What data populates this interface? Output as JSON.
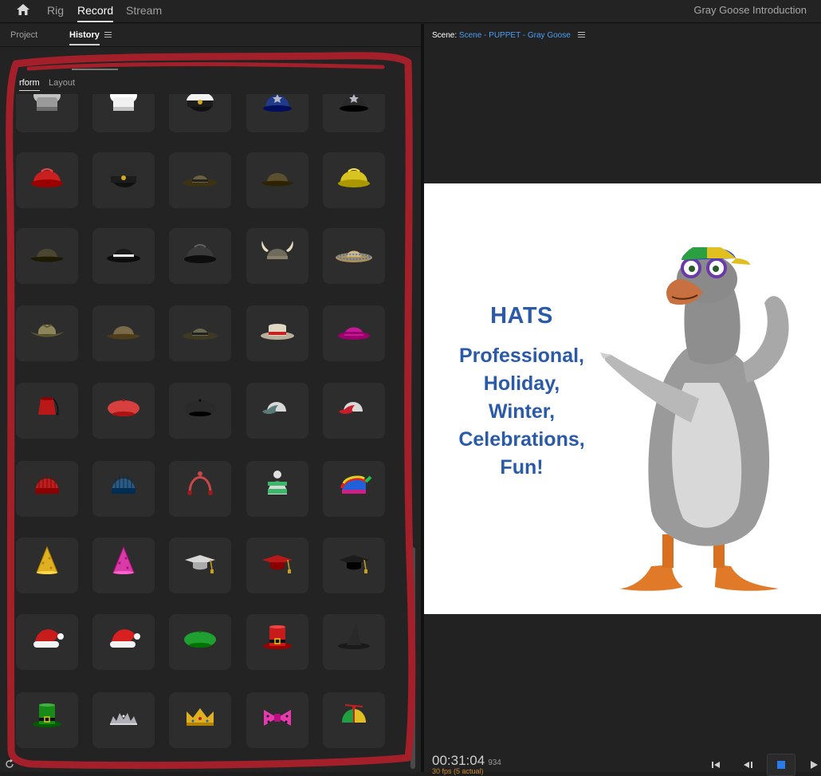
{
  "topbar": {
    "tabs": [
      {
        "label": "Rig",
        "active": false
      },
      {
        "label": "Record",
        "active": true
      },
      {
        "label": "Stream",
        "active": false
      }
    ],
    "document_title": "Gray Goose Introduction"
  },
  "left_panel": {
    "tabs": [
      {
        "label": "Project",
        "active": false
      },
      {
        "label": "History",
        "active": true
      }
    ],
    "mode_tabs": [
      {
        "label": "rform",
        "active": true
      },
      {
        "label": "Layout",
        "active": false
      }
    ],
    "hats": [
      {
        "name": "chef-hat-grey",
        "kind": "chef",
        "color": "#9a9a9a"
      },
      {
        "name": "chef-hat-white",
        "kind": "chef",
        "color": "#f0f0f0"
      },
      {
        "name": "captain-hat",
        "kind": "captain",
        "color": "#f2f2f2"
      },
      {
        "name": "police-helmet-blue",
        "kind": "bobby",
        "color": "#1f3b8a"
      },
      {
        "name": "police-helmet-black",
        "kind": "bobby",
        "color": "#2a2a2a"
      },
      {
        "name": "firefighter-helmet",
        "kind": "helmet",
        "color": "#c82020"
      },
      {
        "name": "pilot-cap",
        "kind": "captain",
        "color": "#2b2b2b"
      },
      {
        "name": "ranger-hat",
        "kind": "flatbrim",
        "color": "#6a6040"
      },
      {
        "name": "safari-hat",
        "kind": "bucket",
        "color": "#5a5030"
      },
      {
        "name": "hard-hat-yellow",
        "kind": "helmet",
        "color": "#d8c420"
      },
      {
        "name": "bucket-hat-olive",
        "kind": "bucket",
        "color": "#4a4630"
      },
      {
        "name": "bowler-hat",
        "kind": "bowler",
        "color": "#1a1a1a"
      },
      {
        "name": "war-helmet",
        "kind": "helmet",
        "color": "#3a3a3a"
      },
      {
        "name": "viking-helmet",
        "kind": "viking",
        "color": "#6e6a5e"
      },
      {
        "name": "sombrero",
        "kind": "sombrero",
        "color": "#a8905a"
      },
      {
        "name": "cowboy-hat-tan",
        "kind": "cowboy",
        "color": "#8c845a"
      },
      {
        "name": "explorer-hat",
        "kind": "bucket",
        "color": "#7a6a48"
      },
      {
        "name": "wide-brim-hat",
        "kind": "flatbrim",
        "color": "#6a6650"
      },
      {
        "name": "boater-hat",
        "kind": "boater",
        "color": "#b8b09a"
      },
      {
        "name": "pink-fedora",
        "kind": "fedora",
        "color": "#c8189a"
      },
      {
        "name": "fez",
        "kind": "fez",
        "color": "#b81818"
      },
      {
        "name": "beret-red",
        "kind": "beret",
        "color": "#d84040"
      },
      {
        "name": "beret-black",
        "kind": "beret",
        "color": "#2a2a2a"
      },
      {
        "name": "baseball-cap-teal",
        "kind": "cap",
        "color": "#5a7a7a"
      },
      {
        "name": "baseball-cap-red",
        "kind": "cap",
        "color": "#c81c28"
      },
      {
        "name": "knit-hat-red",
        "kind": "beanie",
        "color": "#b82020"
      },
      {
        "name": "knit-hat-blue",
        "kind": "beanie",
        "color": "#2c5a80"
      },
      {
        "name": "earmuff-headband",
        "kind": "headband",
        "color": "#c84848"
      },
      {
        "name": "striped-beanie",
        "kind": "pombeanie",
        "color": "#3cb86a"
      },
      {
        "name": "rainbow-beanie",
        "kind": "rainbow",
        "color": "#d02088"
      },
      {
        "name": "party-hat-gold",
        "kind": "cone",
        "color": "#e0b020"
      },
      {
        "name": "party-hat-pink",
        "kind": "cone",
        "color": "#d83aa8"
      },
      {
        "name": "graduation-cap-white",
        "kind": "mortar",
        "color": "#d8d8d8"
      },
      {
        "name": "graduation-cap-red",
        "kind": "mortar",
        "color": "#b81818"
      },
      {
        "name": "graduation-cap-black",
        "kind": "mortar",
        "color": "#1c1c1c"
      },
      {
        "name": "reindeer-santa-hat",
        "kind": "santa",
        "color": "#c81c1c"
      },
      {
        "name": "santa-hat",
        "kind": "santa",
        "color": "#d82020"
      },
      {
        "name": "green-elf-cap",
        "kind": "beret",
        "color": "#20a030"
      },
      {
        "name": "uncle-sam-hat",
        "kind": "tophat",
        "color": "#c81c1c"
      },
      {
        "name": "witch-hat",
        "kind": "witch",
        "color": "#1a1a1a"
      },
      {
        "name": "leprechaun-hat",
        "kind": "tophat",
        "color": "#188a18"
      },
      {
        "name": "silver-tiara",
        "kind": "tiara",
        "color": "#b0b0b8"
      },
      {
        "name": "gold-crown",
        "kind": "crown",
        "color": "#e0b020"
      },
      {
        "name": "polka-dot-bow",
        "kind": "bow",
        "color": "#e83ab0"
      },
      {
        "name": "propeller-beanie",
        "kind": "propeller",
        "color": "#2040c8"
      }
    ]
  },
  "right_panel": {
    "scene_label": "Scene:",
    "scene_name": "Scene - PUPPET - Gray Goose",
    "stage": {
      "title": "HATS",
      "lines": [
        "Professional,",
        "Holiday,",
        "Winter,",
        "Celebrations,",
        "Fun!"
      ],
      "text_color": "#2a5aa8"
    },
    "timecode": "00:31:04",
    "frame_count": "934",
    "fps_text": "30 fps (5 actual)"
  },
  "icons": [
    "home-icon",
    "menu-icon",
    "refresh-icon",
    "go-to-start-icon",
    "step-back-icon",
    "stop-icon",
    "play-icon"
  ],
  "colors": {
    "annotation_red": "#a3202a",
    "accent_blue": "#4a9ff5"
  }
}
